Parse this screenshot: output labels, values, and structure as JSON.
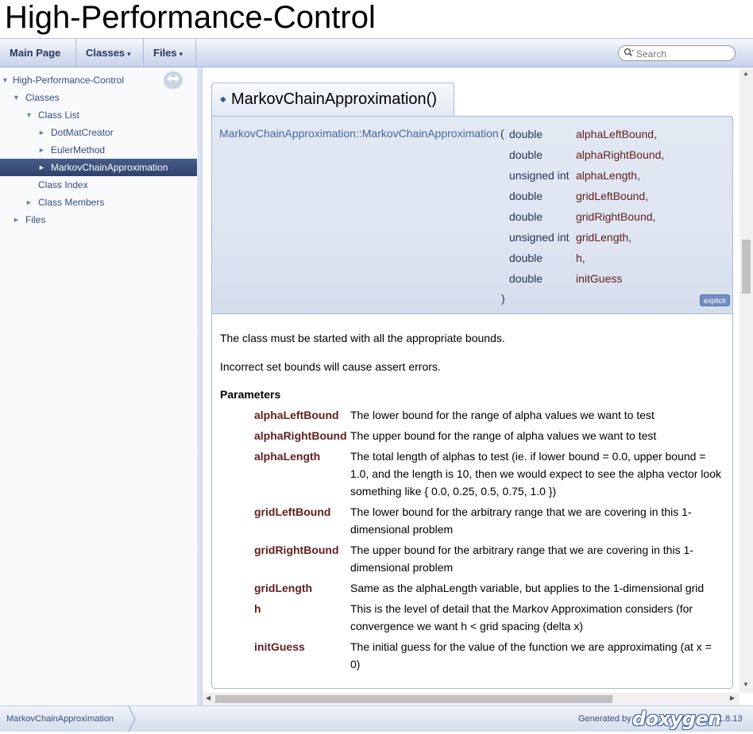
{
  "project": {
    "name": "High-Performance-Control"
  },
  "navbar": {
    "items": [
      {
        "label": "Main Page",
        "has_menu": false
      },
      {
        "label": "Classes",
        "has_menu": true
      },
      {
        "label": "Files",
        "has_menu": true
      }
    ],
    "search_placeholder": "Search",
    "caret": "▾"
  },
  "side_nav": {
    "sync_icon": "sync-arrows-icon",
    "tree": [
      {
        "label": "High-Performance-Control",
        "depth": 0,
        "arrow": "▼"
      },
      {
        "label": "Classes",
        "depth": 1,
        "arrow": "▼"
      },
      {
        "label": "Class List",
        "depth": 2,
        "arrow": "▼"
      },
      {
        "label": "DotMatCreator",
        "depth": 3,
        "arrow": "►"
      },
      {
        "label": "EulerMethod",
        "depth": 3,
        "arrow": "►"
      },
      {
        "label": "MarkovChainApproximation",
        "depth": 3,
        "arrow": "►",
        "selected": true
      },
      {
        "label": "Class Index",
        "depth": 2,
        "arrow": ""
      },
      {
        "label": "Class Members",
        "depth": 2,
        "arrow": "►"
      },
      {
        "label": "Files",
        "depth": 1,
        "arrow": "►"
      }
    ]
  },
  "member": {
    "title": "MarkovChainApproximation()",
    "qualified_name": "MarkovChainApproximation::MarkovChainApproximation",
    "open_paren": "(",
    "close_paren": ")",
    "badge": "explicit",
    "params": [
      {
        "type": "double",
        "name": "alphaLeftBound,"
      },
      {
        "type": "double",
        "name": "alphaRightBound,"
      },
      {
        "type": "unsigned int",
        "name": "alphaLength,"
      },
      {
        "type": "double",
        "name": "gridLeftBound,"
      },
      {
        "type": "double",
        "name": "gridRightBound,"
      },
      {
        "type": "unsigned int",
        "name": "gridLength,"
      },
      {
        "type": "double",
        "name": "h,"
      },
      {
        "type": "double",
        "name": "initGuess"
      }
    ]
  },
  "doc": {
    "para1": "The class must be started with all the appropriate bounds.",
    "para2": "Incorrect set bounds will cause assert errors.",
    "params_heading": "Parameters",
    "params": [
      {
        "name": "alphaLeftBound",
        "lines": [
          "The lower bound for the range of alpha values we want to test"
        ]
      },
      {
        "name": "alphaRightBound",
        "lines": [
          "The upper bound for the range of alpha values we want to test"
        ]
      },
      {
        "name": "alphaLength",
        "lines": [
          "The total length of alphas to test (ie. if lower bound = 0.0, upper bound =",
          "1.0, and the length is 10, then we would expect to see the alpha vector look",
          "something like { 0.0, 0.25, 0.5, 0.75, 1.0 })"
        ]
      },
      {
        "name": "gridLeftBound",
        "lines": [
          "The lower bound for the arbitrary range that we are covering in this 1-",
          "dimensional problem"
        ]
      },
      {
        "name": "gridRightBound",
        "lines": [
          "The upper bound for the arbitrary range that we are covering in this 1-",
          "dimensional problem"
        ]
      },
      {
        "name": "gridLength",
        "lines": [
          "Same as the alphaLength variable, but applies to the 1-dimensional grid"
        ]
      },
      {
        "name": "h",
        "lines": [
          "This is the level of detail that the Markov Approximation considers (for",
          "convergence we want h < grid spacing (delta x)"
        ]
      },
      {
        "name": "initGuess",
        "lines": [
          "The initial guess for the value of the function we are approximating (at x =",
          "0)"
        ]
      }
    ]
  },
  "footer": {
    "nav_path": "MarkovChainApproximation",
    "generated_by": "Generated by",
    "logo_text": "doxygen",
    "version": "1.8.13"
  }
}
